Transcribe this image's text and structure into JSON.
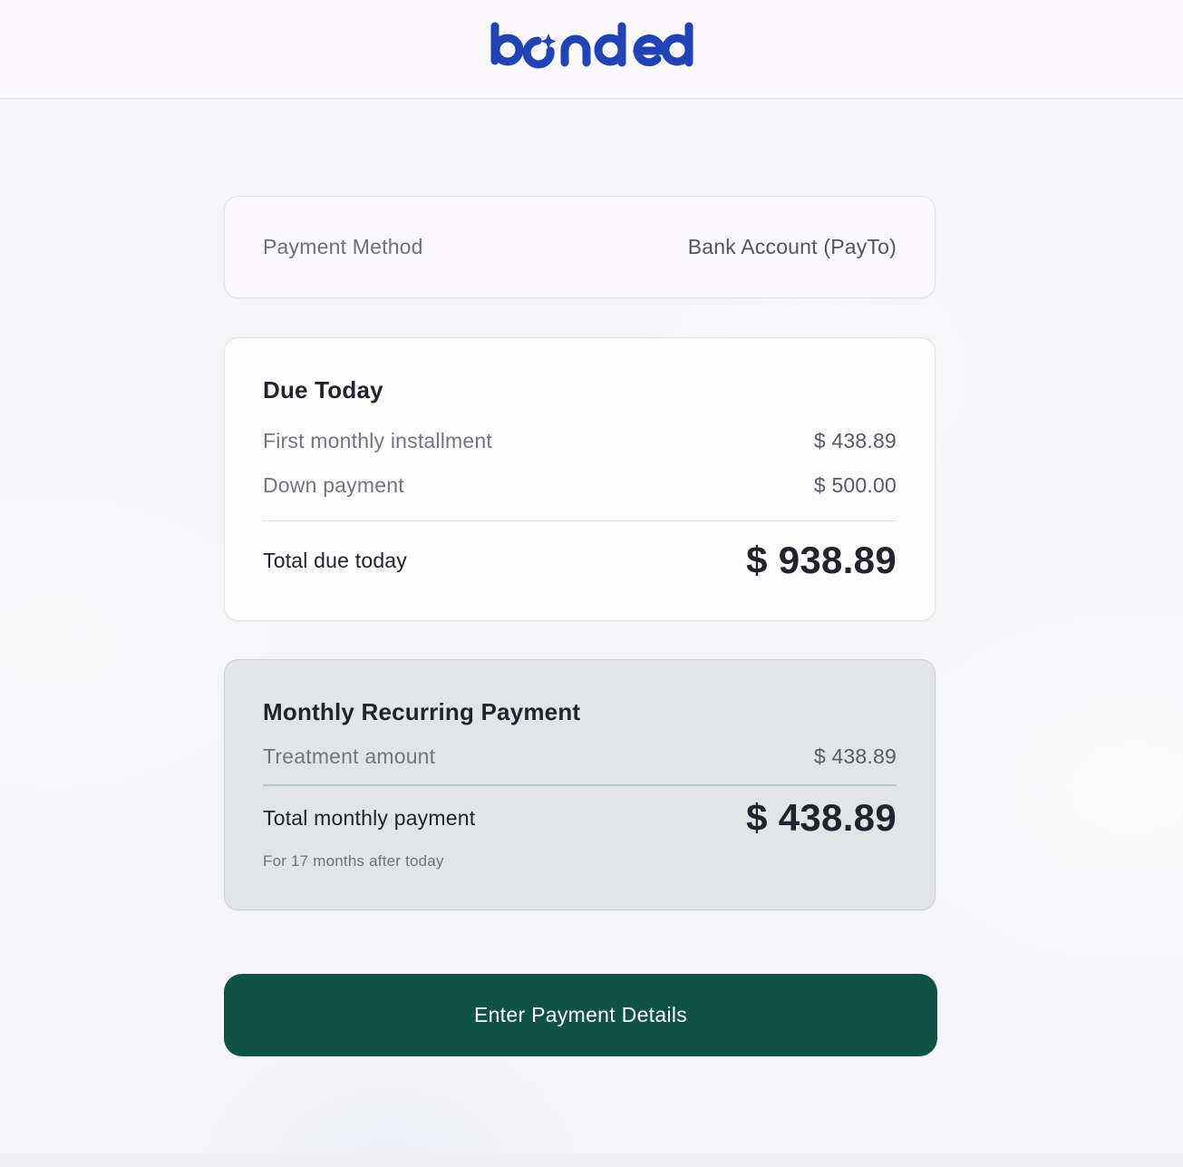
{
  "brand": {
    "logo_text": "bonded",
    "color": "#2243b6"
  },
  "payment_method": {
    "label": "Payment Method",
    "value": "Bank Account (PayTo)"
  },
  "due_today": {
    "title": "Due Today",
    "items": [
      {
        "label": "First monthly installment",
        "value": "$ 438.89"
      },
      {
        "label": "Down payment",
        "value": "$ 500.00"
      }
    ],
    "total_label": "Total due today",
    "total_value": "$ 938.89"
  },
  "monthly": {
    "title": "Monthly Recurring Payment",
    "items": [
      {
        "label": "Treatment amount",
        "value": "$ 438.89"
      }
    ],
    "total_label": "Total monthly payment",
    "total_value": "$ 438.89",
    "note": "For 17 months after today"
  },
  "cta": {
    "label": "Enter Payment Details",
    "color": "#10524a"
  }
}
